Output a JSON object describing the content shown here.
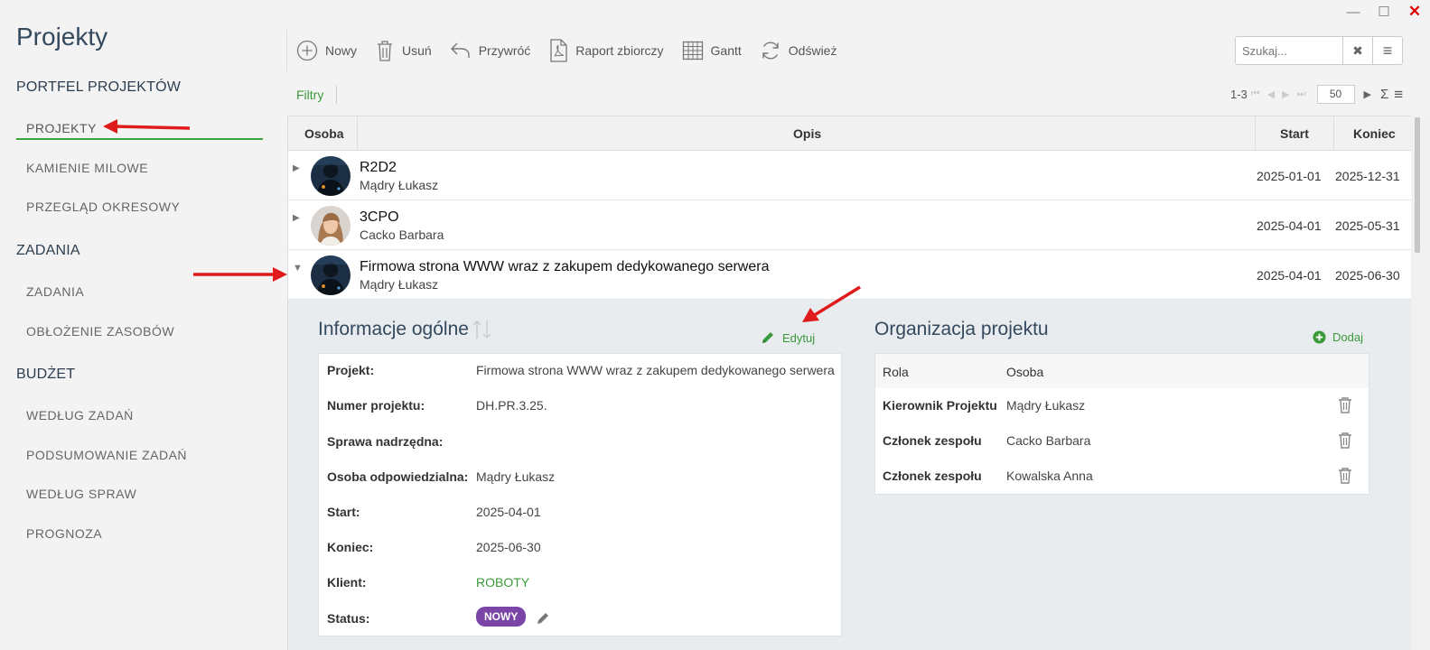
{
  "window": {
    "minimize": "—",
    "maximize": "☐",
    "close": "✕"
  },
  "sidebar": {
    "title": "Projekty",
    "sections": [
      {
        "label": "PORTFEL PROJEKTÓW"
      },
      {
        "label": "ZADANIA"
      },
      {
        "label": "BUDŻET"
      }
    ],
    "items": [
      {
        "label": "PROJEKTY"
      },
      {
        "label": "KAMIENIE MILOWE"
      },
      {
        "label": "PRZEGLĄD OKRESOWY"
      },
      {
        "label": "ZADANIA"
      },
      {
        "label": "OBŁOŻENIE ZASOBÓW"
      },
      {
        "label": "WEDŁUG ZADAŃ"
      },
      {
        "label": "PODSUMOWANIE ZADAŃ"
      },
      {
        "label": "WEDŁUG SPRAW"
      },
      {
        "label": "PROGNOZA"
      }
    ]
  },
  "toolbar": {
    "new": "Nowy",
    "delete": "Usuń",
    "restore": "Przywróć",
    "report": "Raport zbiorczy",
    "gantt": "Gantt",
    "refresh": "Odśwież"
  },
  "search": {
    "placeholder": "Szukaj...",
    "clear": "✖",
    "menu": "≡"
  },
  "filters": {
    "label": "Filtry"
  },
  "pager": {
    "range": "1-3",
    "page_size": "50",
    "sum": "Σ",
    "menu": "≡"
  },
  "grid": {
    "columns": [
      "Osoba",
      "Opis",
      "Start",
      "Koniec"
    ],
    "rows": [
      {
        "title": "R2D2",
        "person": "Mądry Łukasz",
        "start": "2025-01-01",
        "end": "2025-12-31",
        "expanded": false
      },
      {
        "title": "3CPO",
        "person": "Cacko Barbara",
        "start": "2025-04-01",
        "end": "2025-05-31",
        "expanded": false
      },
      {
        "title": "Firmowa strona WWW wraz z zakupem dedykowanego serwera",
        "person": "Mądry Łukasz",
        "start": "2025-04-01",
        "end": "2025-06-30",
        "expanded": true
      }
    ]
  },
  "info": {
    "title": "Informacje ogólne",
    "edit": "Edytuj",
    "fields": [
      {
        "label": "Projekt:",
        "value": "Firmowa strona WWW wraz z zakupem dedykowanego serwera"
      },
      {
        "label": "Numer projektu:",
        "value": "DH.PR.3.25."
      },
      {
        "label": "Sprawa nadrzędna:",
        "value": ""
      },
      {
        "label": "Osoba odpowiedzialna:",
        "value": "Mądry Łukasz"
      },
      {
        "label": "Start:",
        "value": "2025-04-01"
      },
      {
        "label": "Koniec:",
        "value": "2025-06-30"
      },
      {
        "label": "Klient:",
        "value": "ROBOTY"
      },
      {
        "label": "Status:",
        "value": "NOWY"
      }
    ]
  },
  "org": {
    "title": "Organizacja projektu",
    "add": "Dodaj",
    "columns": [
      "Rola",
      "Osoba"
    ],
    "rows": [
      {
        "role": "Kierownik Projektu",
        "person": "Mądry Łukasz"
      },
      {
        "role": "Członek zespołu",
        "person": "Cacko Barbara"
      },
      {
        "role": "Członek zespołu",
        "person": "Kowalska Anna"
      }
    ]
  },
  "colors": {
    "accent": "#3a9a3a",
    "title": "#34495e",
    "badge": "#7b45a8",
    "annotation_arrow": "#e01b1b"
  }
}
